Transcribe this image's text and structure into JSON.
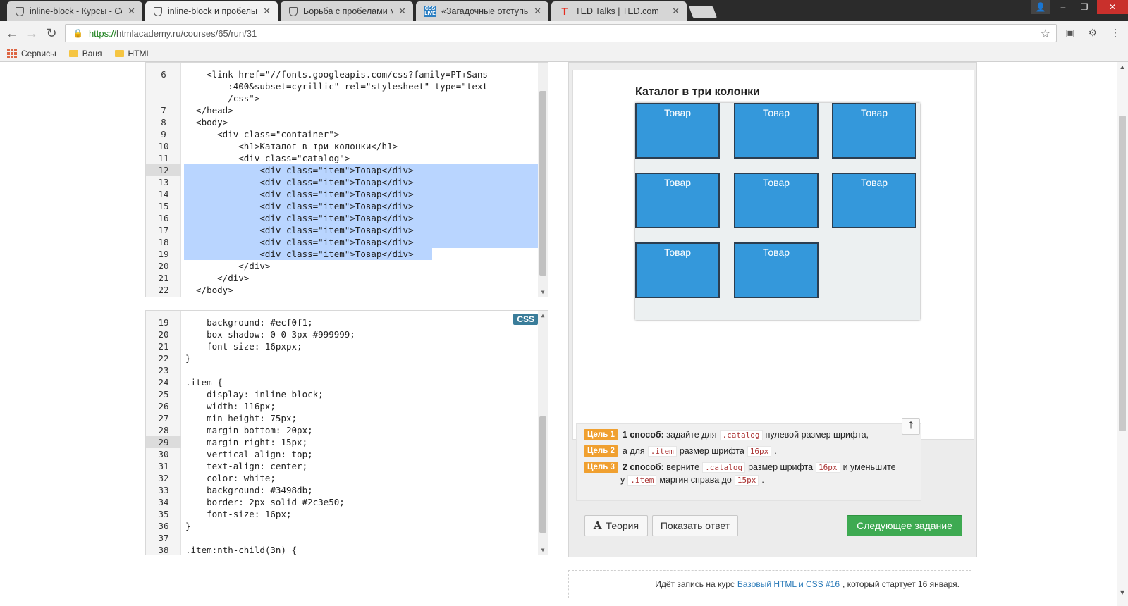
{
  "browser": {
    "tabs": [
      {
        "title": "inline-block - Курсы - Сс",
        "icon": "shield-icon",
        "active": false
      },
      {
        "title": "inline-block и пробелы",
        "icon": "shield-icon",
        "active": true
      },
      {
        "title": "Борьба с пробелами ме",
        "icon": "shield-icon",
        "active": false
      },
      {
        "title": "«Загадочные отступы»",
        "icon": "css-live-icon",
        "active": false
      },
      {
        "title": "TED Talks | TED.com",
        "icon": "ted-icon",
        "active": false
      }
    ],
    "url_secure": "https://",
    "url_rest": "htmlacademy.ru/courses/65/run/31",
    "bookmarks": [
      {
        "label": "Сервисы",
        "icon": "apps-icon"
      },
      {
        "label": "Ваня",
        "icon": "folder-icon"
      },
      {
        "label": "HTML",
        "icon": "folder-icon"
      }
    ]
  },
  "html_editor": {
    "lines": [
      {
        "n": "6",
        "code": "    <link href=\"//fonts.googleapis.com/css?family=PT+Sans"
      },
      {
        "n": "",
        "code": "        :400&subset=cyrillic\" rel=\"stylesheet\" type=\"text"
      },
      {
        "n": "",
        "code": "        /css\">"
      },
      {
        "n": "7",
        "code": "  </head>"
      },
      {
        "n": "8",
        "code": "  <body>"
      },
      {
        "n": "9",
        "code": "      <div class=\"container\">"
      },
      {
        "n": "10",
        "code": "          <h1>Каталог в три колонки</h1>"
      },
      {
        "n": "11",
        "code": "          <div class=\"catalog\">"
      },
      {
        "n": "12",
        "code": "              <div class=\"item\">Товар</div>"
      },
      {
        "n": "13",
        "code": "              <div class=\"item\">Товар</div>"
      },
      {
        "n": "14",
        "code": "              <div class=\"item\">Товар</div>"
      },
      {
        "n": "15",
        "code": "              <div class=\"item\">Товар</div>"
      },
      {
        "n": "16",
        "code": "              <div class=\"item\">Товар</div>"
      },
      {
        "n": "17",
        "code": "              <div class=\"item\">Товар</div>"
      },
      {
        "n": "18",
        "code": "              <div class=\"item\">Товар</div>"
      },
      {
        "n": "19",
        "code": "              <div class=\"item\">Товар</div>"
      },
      {
        "n": "20",
        "code": "          </div>"
      },
      {
        "n": "21",
        "code": "      </div>"
      },
      {
        "n": "22",
        "code": "  </body>"
      }
    ],
    "current_line": "12"
  },
  "css_editor": {
    "badge": "CSS",
    "lines": [
      {
        "n": "19",
        "code": "    background: #ecf0f1;"
      },
      {
        "n": "20",
        "code": "    box-shadow: 0 0 3px #999999;"
      },
      {
        "n": "21",
        "code": "    font-size: 16pxpx;"
      },
      {
        "n": "22",
        "code": "}"
      },
      {
        "n": "23",
        "code": ""
      },
      {
        "n": "24",
        "code": ".item {"
      },
      {
        "n": "25",
        "code": "    display: inline-block;"
      },
      {
        "n": "26",
        "code": "    width: 116px;"
      },
      {
        "n": "27",
        "code": "    min-height: 75px;"
      },
      {
        "n": "28",
        "code": "    margin-bottom: 20px;"
      },
      {
        "n": "29",
        "code": "    margin-right: 15px;"
      },
      {
        "n": "30",
        "code": "    vertical-align: top;"
      },
      {
        "n": "31",
        "code": "    text-align: center;"
      },
      {
        "n": "32",
        "code": "    color: white;"
      },
      {
        "n": "33",
        "code": "    background: #3498db;"
      },
      {
        "n": "34",
        "code": "    border: 2px solid #2c3e50;"
      },
      {
        "n": "35",
        "code": "    font-size: 16px;"
      },
      {
        "n": "36",
        "code": "}"
      },
      {
        "n": "37",
        "code": ""
      },
      {
        "n": "38",
        "code": ".item:nth-child(3n) {"
      }
    ],
    "current_line": "29"
  },
  "preview": {
    "title": "Каталог в три колонки",
    "items": [
      "Товар",
      "Товар",
      "Товар",
      "Товар",
      "Товар",
      "Товар",
      "Товар",
      "Товар"
    ],
    "colors": {
      "item_bg": "#3498db",
      "item_border": "#2c3e50",
      "catalog_bg": "#ecf0f1"
    }
  },
  "tasks": {
    "goal1": {
      "badge": "Цель 1",
      "bold": "1 способ:",
      "t1": "задайте для",
      "c1": ".catalog",
      "t2": "нулевой размер шрифта,"
    },
    "goal2": {
      "badge": "Цель 2",
      "t1": "а для",
      "c1": ".item",
      "t2": "размер шрифта",
      "c2": "16px",
      "t3": "."
    },
    "goal3": {
      "badge": "Цель 3",
      "bold": "2 способ:",
      "t1": "верните",
      "c1": ".catalog",
      "t2": "размер шрифта",
      "c2": "16px",
      "t3": "и уменьшите",
      "t4": "у",
      "c3": ".item",
      "t5": "маргин справа до",
      "c4": "15px",
      "t6": "."
    }
  },
  "buttons": {
    "theory": "Теория",
    "show_answer": "Показать ответ",
    "next_task": "Следующее задание"
  },
  "enroll": {
    "t1": "Идёт запись на курс",
    "link": "Базовый HTML и CSS #16",
    "t2": ", который стартует 16 января."
  },
  "colors": {
    "accent_green": "#3eaa52",
    "goal_badge": "#f0a030",
    "selection": "#b9d5ff"
  }
}
